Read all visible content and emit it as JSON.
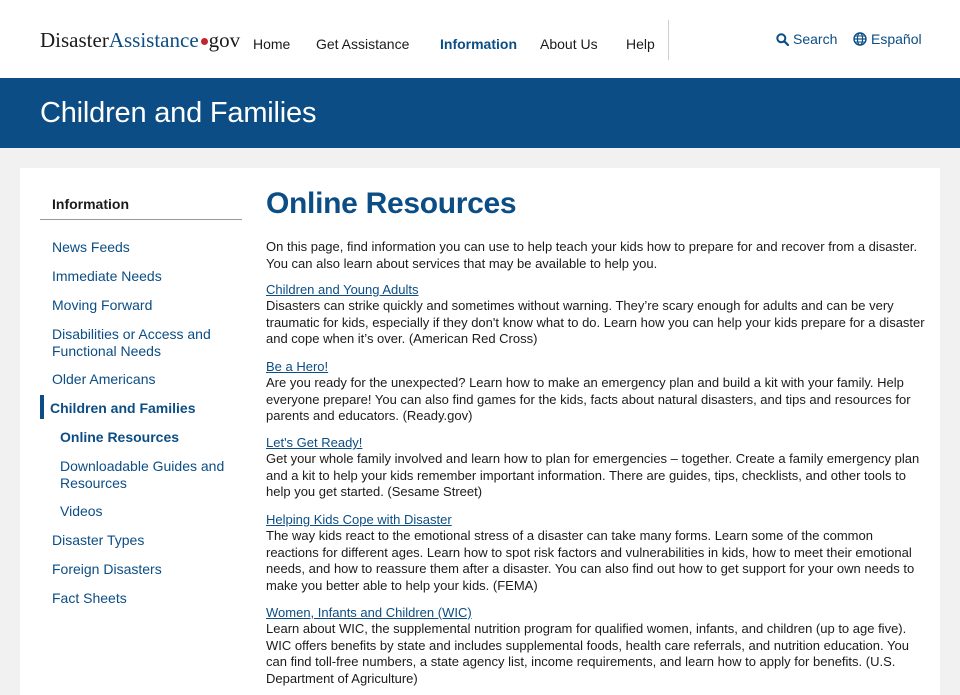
{
  "header": {
    "logo": {
      "part1": "Disaster",
      "part2": "Assistance",
      "part3": "gov"
    },
    "nav": [
      "Home",
      "Get Assistance",
      "Information",
      "About Us",
      "Help"
    ],
    "active_nav": "Information",
    "search_label": "Search",
    "language_label": "Español"
  },
  "banner": {
    "title": "Children and Families"
  },
  "sidebar": {
    "title": "Information",
    "items": [
      "News Feeds",
      "Immediate Needs",
      "Moving Forward",
      "Disabilities or Access and Functional Needs",
      "Older Americans",
      "Children and Families",
      "Online Resources",
      "Downloadable Guides and Resources",
      "Videos",
      "Disaster Types",
      "Foreign Disasters",
      "Fact Sheets"
    ]
  },
  "main": {
    "title": "Online Resources",
    "intro": "On this page, find information you can use to help teach your kids how to prepare for and recover from a disaster. You can also learn about services that may be available to help you.",
    "resources": [
      {
        "title": "Children and Young Adults",
        "desc": "Disasters can strike quickly and sometimes without warning. They’re scary enough for adults and can be very traumatic for kids, especially if they don't know what to do. Learn how you can help your kids prepare for a disaster and cope when it’s over. (American Red Cross)"
      },
      {
        "title": "Be a Hero!",
        "desc": "Are you ready for the unexpected? Learn how to make an emergency plan and build a kit with your family. Help everyone prepare! You can also find games for the kids, facts about natural disasters, and tips and resources for parents and educators. (Ready.gov)"
      },
      {
        "title": "Let's Get Ready!",
        "desc": "Get your whole family involved and learn how to plan for emergencies – together. Create a family emergency plan and a kit to help your kids remember important information. There are guides, tips, checklists, and other tools to help you get started. (Sesame Street)"
      },
      {
        "title": "Helping Kids Cope with Disaster",
        "desc": "The way kids react to the emotional stress of a disaster can take many forms. Learn some of the common reactions for different ages. Learn how to spot risk factors and vulnerabilities in kids, how to meet their emotional needs, and how to reassure them after a disaster. You can also find out how to get support for your own needs to make you better able to help your kids. (FEMA)"
      },
      {
        "title": "Women, Infants and Children (WIC)",
        "desc": "Learn about WIC, the supplemental nutrition program for qualified women, infants, and children (up to age five). WIC offers benefits by state and includes supplemental foods, health care referrals, and nutrition education. You can find toll-free numbers, a state agency list, income requirements, and learn how to apply for benefits. (U.S. Department of Agriculture)"
      }
    ]
  },
  "colors": {
    "brand_blue": "#0b4d84",
    "logo_dot": "#c0272d",
    "background": "#f1f1f1"
  }
}
